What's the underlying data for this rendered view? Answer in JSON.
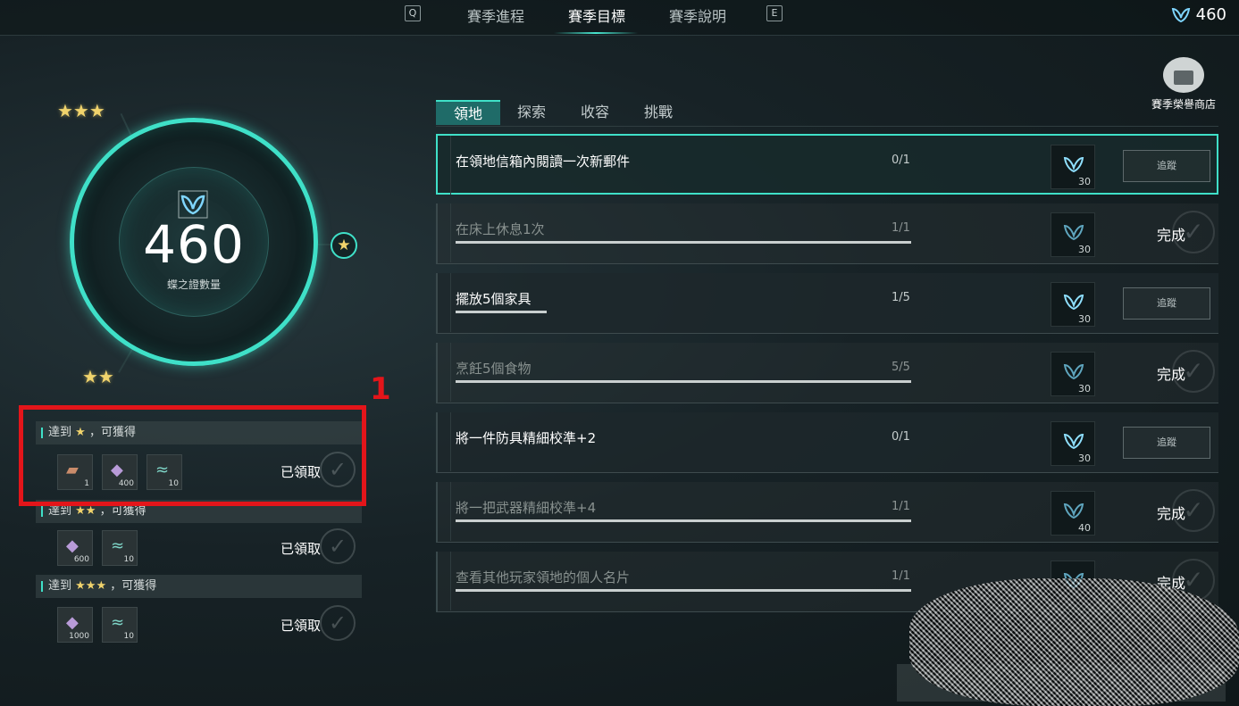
{
  "top_nav": {
    "key_left": "Q",
    "key_right": "E",
    "tabs": [
      {
        "label": "賽季進程"
      },
      {
        "label": "賽季目標"
      },
      {
        "label": "賽季說明"
      }
    ],
    "active_tab": "賽季目標"
  },
  "currency": {
    "icon": "butterfly-emblem-icon",
    "value": "460"
  },
  "ring": {
    "value": "460",
    "caption": "蝶之證數量"
  },
  "milestone_stars": {
    "top": "★★★",
    "right": "★",
    "bottom": "★★"
  },
  "rewards": [
    {
      "head_prefix": "達到",
      "head_stars": "★",
      "head_suffix": "，可獲得",
      "items": [
        {
          "icon": "ticket-item-icon",
          "count": "1"
        },
        {
          "icon": "crystal-item-icon",
          "count": "400"
        },
        {
          "icon": "path-item-icon",
          "count": "10"
        }
      ],
      "status": "已領取"
    },
    {
      "head_prefix": "達到",
      "head_stars": "★★",
      "head_suffix": "，可獲得",
      "items": [
        {
          "icon": "crystal-item-icon",
          "count": "600"
        },
        {
          "icon": "path-item-icon",
          "count": "10"
        }
      ],
      "status": "已領取"
    },
    {
      "head_prefix": "達到",
      "head_stars": "★★★",
      "head_suffix": "，可獲得",
      "items": [
        {
          "icon": "crystal-item-icon",
          "count": "1000"
        },
        {
          "icon": "path-item-icon",
          "count": "10"
        }
      ],
      "status": "已領取"
    }
  ],
  "annotation": {
    "number": "1"
  },
  "sub_tabs": [
    {
      "label": "領地"
    },
    {
      "label": "探索"
    },
    {
      "label": "收容"
    },
    {
      "label": "挑戰"
    }
  ],
  "shop": {
    "label": "賽季榮譽商店"
  },
  "quests": [
    {
      "title": "在領地信箱內閱讀一次新郵件",
      "progress": "0/1",
      "fill": 0,
      "reward": "30",
      "action": "追蹤",
      "state": "selected"
    },
    {
      "title": "在床上休息1次",
      "progress": "1/1",
      "fill": 1,
      "reward": "30",
      "action": "完成",
      "state": "done"
    },
    {
      "title": "擺放5個家具",
      "progress": "1/5",
      "fill": 0.2,
      "reward": "30",
      "action": "追蹤",
      "state": "active"
    },
    {
      "title": "烹飪5個食物",
      "progress": "5/5",
      "fill": 1,
      "reward": "30",
      "action": "完成",
      "state": "done"
    },
    {
      "title": "將一件防具精細校準+2",
      "progress": "0/1",
      "fill": 0,
      "reward": "30",
      "action": "追蹤",
      "state": "active"
    },
    {
      "title": "將一把武器精細校準+4",
      "progress": "1/1",
      "fill": 1,
      "reward": "40",
      "action": "完成",
      "state": "done"
    },
    {
      "title": "查看其他玩家領地的個人名片",
      "progress": "1/1",
      "fill": 1,
      "reward": "",
      "action": "完成",
      "state": "done"
    }
  ],
  "colors": {
    "accent": "#3fe0c8",
    "annotation": "#e3151a",
    "star": "#f0d36c"
  }
}
